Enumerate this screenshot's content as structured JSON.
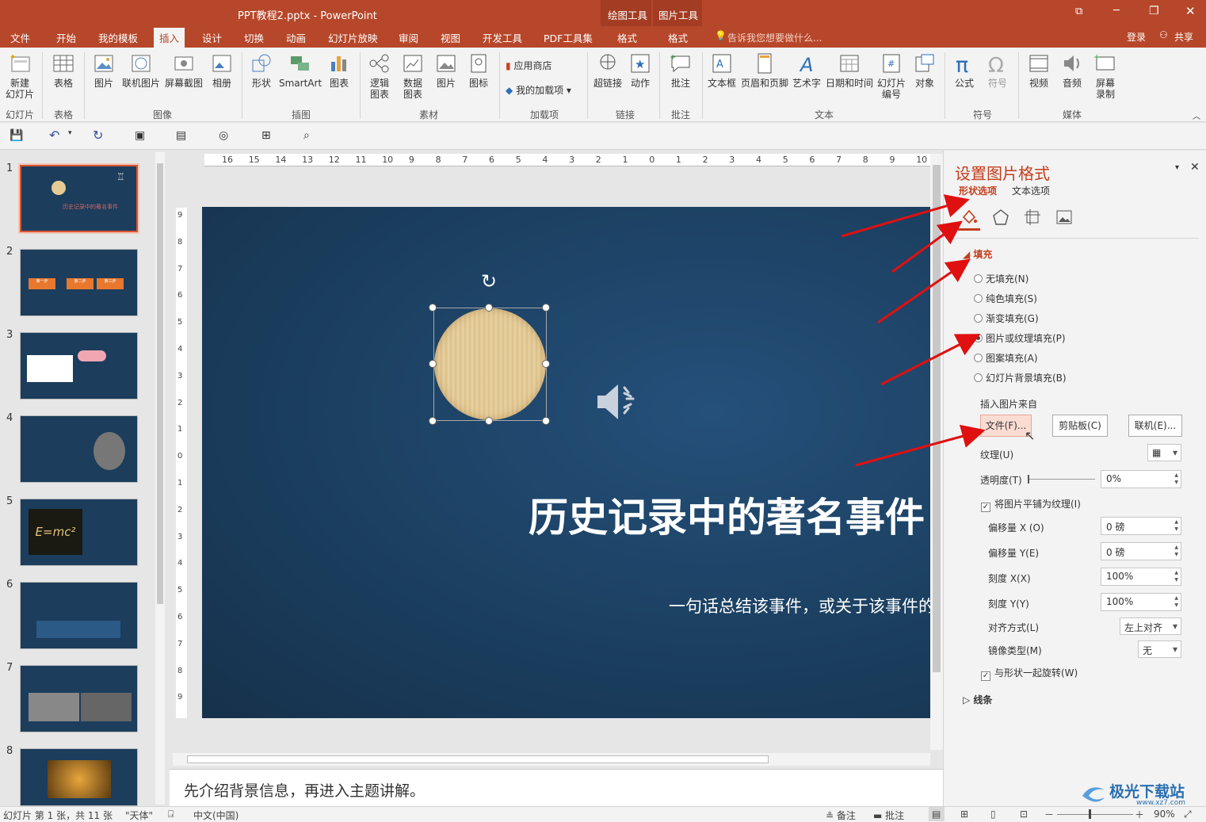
{
  "window": {
    "title": "PPT教程2.pptx - PowerPoint",
    "ctx_draw": "绘图工具",
    "ctx_pic": "图片工具",
    "min": "─",
    "restore": "❐",
    "close": "✕",
    "ribbon_opt": "⧉"
  },
  "tabs": [
    "文件",
    "开始",
    "我的模板",
    "插入",
    "设计",
    "切换",
    "动画",
    "幻灯片放映",
    "审阅",
    "视图",
    "开发工具",
    "PDF工具集",
    "格式",
    "格式"
  ],
  "tell_me": "告诉我您想要做什么...",
  "login": "登录",
  "share": "共享",
  "ribbon": {
    "new_slide": "新建\n幻灯片",
    "table": "表格",
    "picture": "图片",
    "online_pic": "联机图片",
    "screenshot": "屏幕截图",
    "album": "相册",
    "shapes": "形状",
    "smartart": "SmartArt",
    "chart": "图表",
    "logic_chart": "逻辑\n图表",
    "data_chart": "数据\n图表",
    "material_pic": "图片",
    "icon": "图标",
    "store": "应用商店",
    "my_addins": "我的加载项",
    "hyperlink": "超链接",
    "action": "动作",
    "comment": "批注",
    "textbox": "文本框",
    "header_footer": "页眉和页脚",
    "wordart": "艺术字",
    "datetime": "日期和时间",
    "slide_num": "幻灯片\n编号",
    "object": "对象",
    "equation": "公式",
    "symbol": "符号",
    "video": "视频",
    "audio": "音频",
    "screen_rec": "屏幕\n录制",
    "groups": {
      "slides": "幻灯片",
      "tables": "表格",
      "images": "图像",
      "illustrations": "插图",
      "material": "素材",
      "addins": "加载项",
      "links": "链接",
      "comments": "批注",
      "text": "文本",
      "symbols": "符号",
      "media": "媒体"
    }
  },
  "slides": [
    {
      "n": "1"
    },
    {
      "n": "2"
    },
    {
      "n": "3"
    },
    {
      "n": "4"
    },
    {
      "n": "5"
    },
    {
      "n": "6"
    },
    {
      "n": "7"
    },
    {
      "n": "8"
    }
  ],
  "thumb_texts": {
    "t1": "历史记录中的著名事件",
    "t2a": "第一步",
    "t2b": "第二步",
    "t2c": "第三步",
    "t5": "E=mc²"
  },
  "ruler_h": [
    "16",
    "15",
    "14",
    "13",
    "12",
    "11",
    "10",
    "9",
    "8",
    "7",
    "6",
    "5",
    "4",
    "3",
    "2",
    "1",
    "0",
    "1",
    "2",
    "3",
    "4",
    "5",
    "6",
    "7",
    "8",
    "9",
    "10"
  ],
  "ruler_v": [
    "9",
    "8",
    "7",
    "6",
    "5",
    "4",
    "3",
    "2",
    "1",
    "0",
    "1",
    "2",
    "3",
    "4",
    "5",
    "6",
    "7",
    "8",
    "9"
  ],
  "slide": {
    "title": "历史记录中的著名事件",
    "subtitle": "一句话总结该事件，或关于该事件的"
  },
  "notes": "先介绍背景信息，再进入主题讲解。",
  "pane": {
    "title": "设置图片格式",
    "tab_shape": "形状选项",
    "tab_text": "文本选项",
    "fill_section": "填充",
    "no_fill": "无填充(N)",
    "solid_fill": "纯色填充(S)",
    "gradient_fill": "渐变填充(G)",
    "picture_fill": "图片或纹理填充(P)",
    "pattern_fill": "图案填充(A)",
    "bg_fill": "幻灯片背景填充(B)",
    "insert_from": "插入图片来自",
    "file_btn": "文件(F)...",
    "clipboard_btn": "剪贴板(C)",
    "online_btn": "联机(E)...",
    "texture": "纹理(U)",
    "transparency": "透明度(T)",
    "transparency_val": "0%",
    "tile": "将图片平铺为纹理(I)",
    "offset_x": "偏移量 X (O)",
    "offset_x_val": "0 磅",
    "offset_y": "偏移量 Y(E)",
    "offset_y_val": "0 磅",
    "scale_x": "刻度 X(X)",
    "scale_x_val": "100%",
    "scale_y": "刻度 Y(Y)",
    "scale_y_val": "100%",
    "align": "对齐方式(L)",
    "align_val": "左上对齐",
    "mirror": "镜像类型(M)",
    "mirror_val": "无",
    "rotate": "与形状一起旋转(W)",
    "line_section": "线条"
  },
  "status": {
    "slide_info": "幻灯片 第 1 张，共 11 张",
    "theme": "\"天体\"",
    "lang": "中文(中国)",
    "notes": "备注",
    "comments": "批注",
    "zoom": "90%"
  },
  "watermark": "极光下载站",
  "watermark_url": "www.xz7.com"
}
